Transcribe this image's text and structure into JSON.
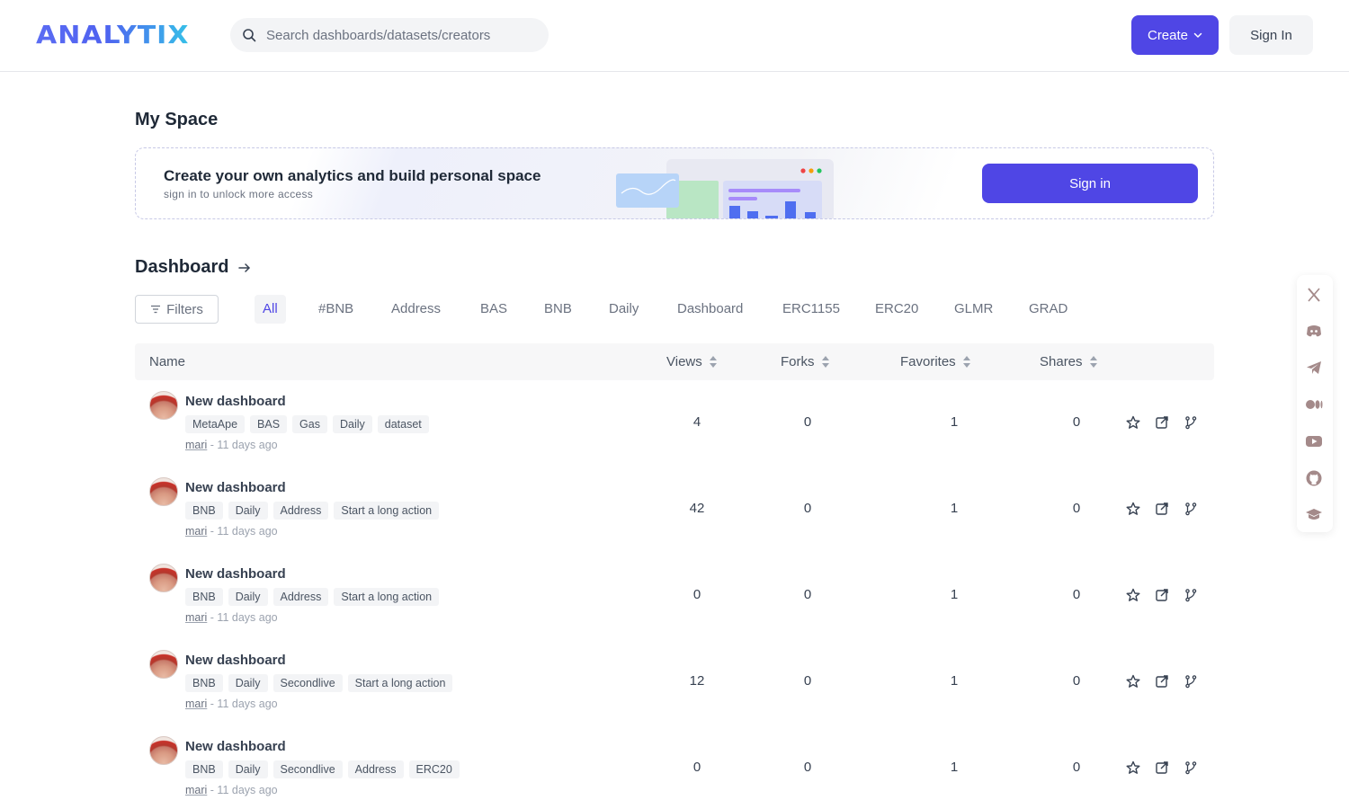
{
  "header": {
    "logo_text": "ANALYTIX",
    "search_placeholder": "Search dashboards/datasets/creators",
    "create_label": "Create",
    "signin_label": "Sign In"
  },
  "myspace": {
    "title": "My Space",
    "banner_title": "Create your own analytics and build personal space",
    "banner_subtitle": "sign in to unlock more access",
    "banner_button": "Sign in"
  },
  "dashboard": {
    "title": "Dashboard",
    "filters_label": "Filters",
    "tags": [
      "All",
      "#BNB",
      "Address",
      "BAS",
      "BNB",
      "Daily",
      "Dashboard",
      "ERC1155",
      "ERC20",
      "GLMR",
      "GRAD"
    ],
    "active_tag": "All",
    "columns": {
      "name": "Name",
      "views": "Views",
      "forks": "Forks",
      "favorites": "Favorites",
      "shares": "Shares"
    },
    "rows": [
      {
        "title": "New dashboard",
        "tags": [
          "MetaApe",
          "BAS",
          "Gas",
          "Daily",
          "dataset"
        ],
        "author": "mari",
        "time": " - 11 days ago",
        "views": "4",
        "forks": "0",
        "favorites": "1",
        "shares": "0"
      },
      {
        "title": "New dashboard",
        "tags": [
          "BNB",
          "Daily",
          "Address",
          "Start a long action"
        ],
        "author": "mari",
        "time": " - 11 days ago",
        "views": "42",
        "forks": "0",
        "favorites": "1",
        "shares": "0"
      },
      {
        "title": "New dashboard",
        "tags": [
          "BNB",
          "Daily",
          "Address",
          "Start a long action"
        ],
        "author": "mari",
        "time": " - 11 days ago",
        "views": "0",
        "forks": "0",
        "favorites": "1",
        "shares": "0"
      },
      {
        "title": "New dashboard",
        "tags": [
          "BNB",
          "Daily",
          "Secondlive",
          "Start a long action"
        ],
        "author": "mari",
        "time": " - 11 days ago",
        "views": "12",
        "forks": "0",
        "favorites": "1",
        "shares": "0"
      },
      {
        "title": "New dashboard",
        "tags": [
          "BNB",
          "Daily",
          "Secondlive",
          "Address",
          "ERC20"
        ],
        "author": "mari",
        "time": " - 11 days ago",
        "views": "0",
        "forks": "0",
        "favorites": "1",
        "shares": "0"
      }
    ]
  },
  "social_icons": [
    "x-icon",
    "discord-icon",
    "telegram-icon",
    "medium-icon",
    "youtube-icon",
    "github-icon",
    "docs-icon"
  ],
  "colors": {
    "accent": "#4f46e5",
    "social_icon": "#a48a8a"
  }
}
